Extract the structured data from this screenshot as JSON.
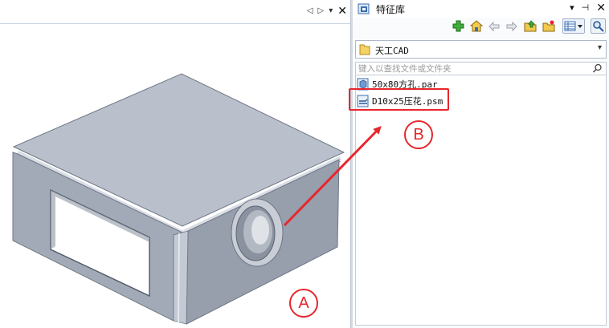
{
  "viewport": {
    "controls": [
      "◁",
      "▷",
      "▾",
      "✕"
    ]
  },
  "panel": {
    "title": "特征库",
    "title_controls": [
      "▾",
      "⊣",
      "✕"
    ],
    "toolbar_icons": [
      "add-icon",
      "home-icon",
      "back-icon",
      "forward-icon",
      "up-folder-icon",
      "new-folder-icon",
      "view-mode-icon",
      "search-icon"
    ],
    "folder_select": {
      "value": "天工CAD",
      "caret": "▾"
    },
    "search": {
      "placeholder": "键入以查找文件或文件夹"
    },
    "files": [
      {
        "name": "50x80方孔.par",
        "icon": "part-file-icon"
      },
      {
        "name": "D10x25压花.psm",
        "icon": "sheetmetal-file-icon"
      }
    ]
  },
  "annotations": {
    "a_label": "A",
    "b_label": "B"
  },
  "colors": {
    "annotation_red": "#e8262c",
    "part_top": "#b8bfca",
    "part_front": "#a2a9b6",
    "part_side": "#959cab"
  }
}
